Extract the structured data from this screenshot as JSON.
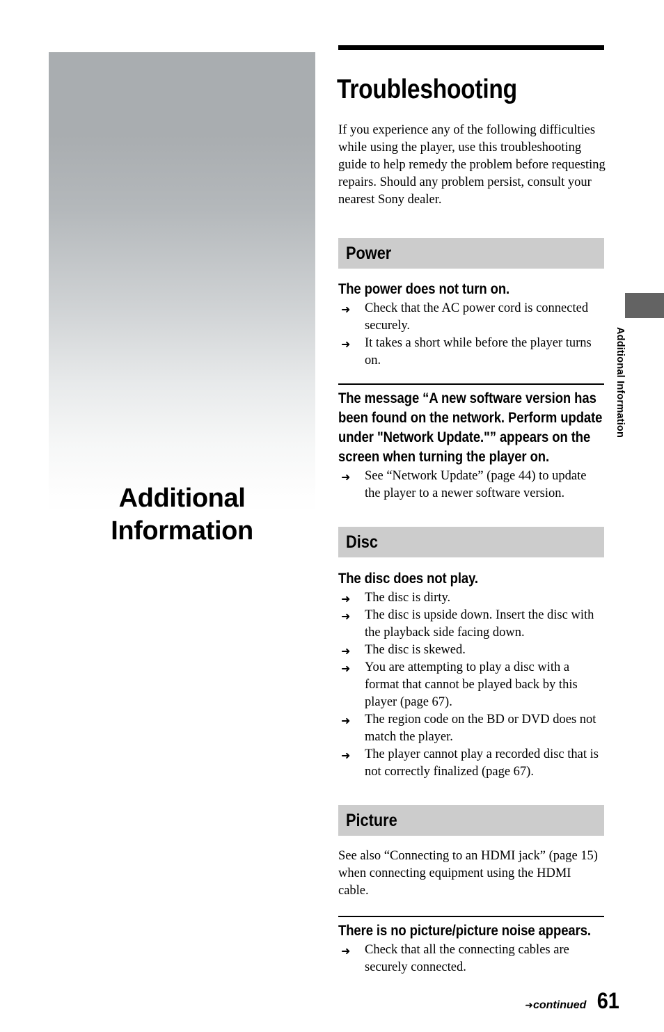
{
  "chapter": {
    "title": "Additional Information"
  },
  "side_tab": {
    "label": "Additional Information"
  },
  "page": {
    "heading": "Troubleshooting",
    "intro": "If you experience any of the following difficulties while using the player, use this troubleshooting guide to help remedy the problem before requesting repairs. Should any problem persist, consult your nearest Sony dealer.",
    "number": "61",
    "continued_label": "continued",
    "continued_arrow": "➜",
    "bullet_arrow": "➜"
  },
  "sections": [
    {
      "band_label": "Power",
      "entries": [
        {
          "question": "The power does not turn on.",
          "answers": [
            "Check that the AC power cord is connected securely.",
            "It takes a short while before the player turns on."
          ]
        },
        {
          "question": "The message “A new software version has been found on the network. Perform update under \"Network Update.\"” appears on the screen when turning the player on.",
          "answers": [
            "See “Network Update” (page 44) to update the player to a newer software version."
          ]
        }
      ]
    },
    {
      "band_label": "Disc",
      "entries": [
        {
          "question": "The disc does not play.",
          "answers": [
            "The disc is dirty.",
            "The disc is upside down. Insert the disc with the playback side facing down.",
            "The disc is skewed.",
            "You are attempting to play a disc with a format that cannot be played back by this player (page 67).",
            "The region code on the BD or DVD does not match the player.",
            "The player cannot play a recorded disc that is not correctly finalized (page 67)."
          ]
        }
      ]
    },
    {
      "band_label": "Picture",
      "note": "See also “Connecting to an HDMI jack” (page 15) when connecting equipment using the HDMI cable.",
      "entries": [
        {
          "question": "There is no picture/picture noise appears.",
          "answers": [
            "Check that all the connecting cables are securely connected."
          ]
        }
      ]
    }
  ],
  "colors": {
    "band_gray": "#cccccc",
    "tab_gray": "#636363",
    "panel_gray": "#a9adb0"
  }
}
